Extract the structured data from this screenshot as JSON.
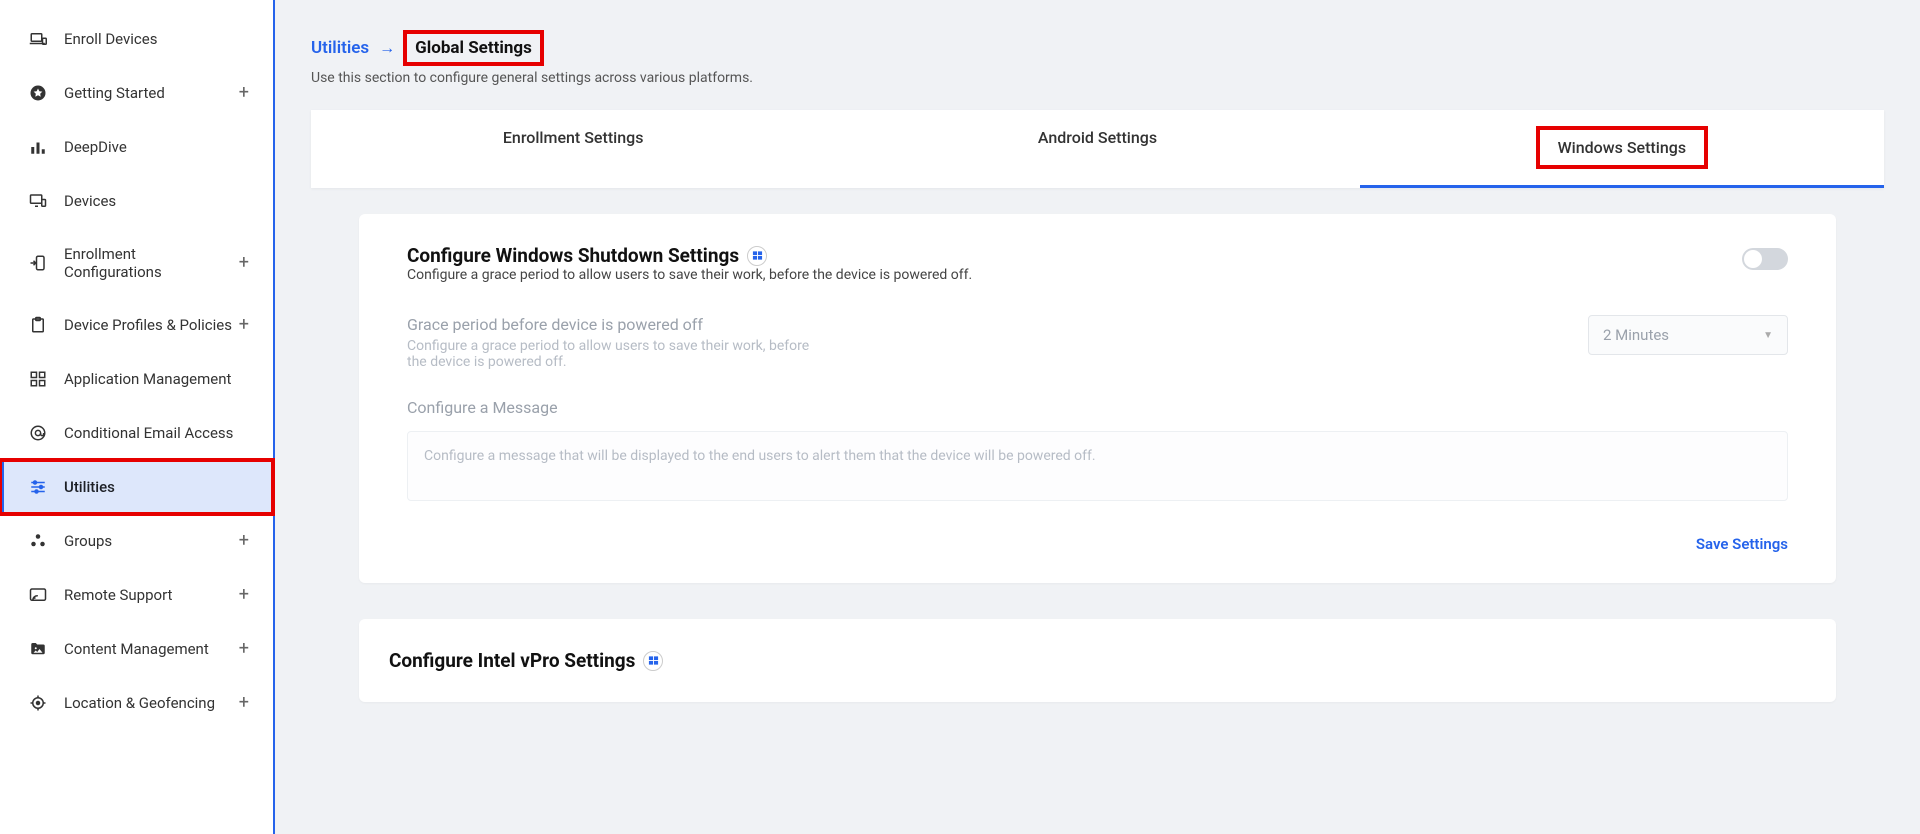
{
  "sidebar": {
    "items": [
      {
        "label": "Enroll Devices",
        "expandable": false
      },
      {
        "label": "Getting Started",
        "expandable": true
      },
      {
        "label": "DeepDive",
        "expandable": false
      },
      {
        "label": "Devices",
        "expandable": false
      },
      {
        "label": "Enrollment Configurations",
        "expandable": true
      },
      {
        "label": "Device Profiles & Policies",
        "expandable": true
      },
      {
        "label": "Application Management",
        "expandable": false
      },
      {
        "label": "Conditional Email Access",
        "expandable": false
      },
      {
        "label": "Utilities",
        "expandable": false,
        "active": true
      },
      {
        "label": "Groups",
        "expandable": true
      },
      {
        "label": "Remote Support",
        "expandable": true
      },
      {
        "label": "Content Management",
        "expandable": true
      },
      {
        "label": "Location & Geofencing",
        "expandable": true
      }
    ]
  },
  "breadcrumb": {
    "parent": "Utilities",
    "current": "Global Settings"
  },
  "page_desc": "Use this section to configure general settings across various platforms.",
  "tabs": [
    {
      "label": "Enrollment Settings",
      "active": false
    },
    {
      "label": "Android Settings",
      "active": false
    },
    {
      "label": "Windows Settings",
      "active": true
    }
  ],
  "shutdown": {
    "title": "Configure Windows Shutdown Settings",
    "desc": "Configure a grace period to allow users to save their work, before the device is powered off.",
    "grace_label": "Grace period before device is powered off",
    "grace_hint": "Configure a grace period to allow users to save their work, before the device is powered off.",
    "grace_value": "2 Minutes",
    "msg_label": "Configure a Message",
    "msg_placeholder": "Configure a message that will be displayed to the end users to alert them that the device will be powered off.",
    "save_label": "Save Settings"
  },
  "vpro": {
    "title": "Configure Intel vPro Settings"
  }
}
